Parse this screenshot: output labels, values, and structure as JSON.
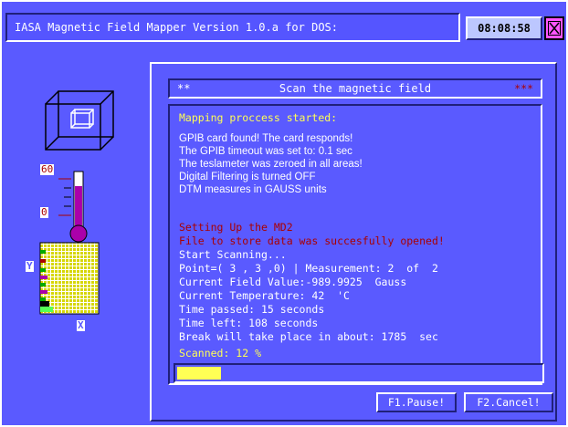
{
  "window": {
    "title": "IASA Magnetic Field Mapper Version 1.0.a for DOS:",
    "clock": "08:08:58"
  },
  "sidebar": {
    "thermometer_top_label": "60",
    "thermometer_zero_label": "0",
    "axis_y_label": "Y",
    "axis_x_label": "X"
  },
  "dialog": {
    "title_left": "**",
    "title": "Scan the magnetic field",
    "title_right": "***",
    "log": {
      "started": "Mapping proccess started:",
      "info": [
        "GPIB card found! The card responds!",
        "The GPIB timeout was set to: 0.1 sec",
        "The teslameter was zeroed in all areas!",
        "Digital Filtering is turned OFF",
        "DTM measures in GAUSS units"
      ],
      "setup": [
        "Setting Up the MD2",
        "File to store data was succesfully opened!"
      ],
      "status": [
        "Start Scanning...",
        "Point=( 3 , 3 ,0) | Measurement: 2  of  2",
        "Current Field Value:-989.9925  Gauss",
        "Current Temperature: 42  'C",
        "Time passed: 15 seconds",
        "Time left: 108 seconds",
        "Break will take place in about: 1785  sec"
      ],
      "scanned": "Scanned: 12 %"
    },
    "progress_fraction": 0.12,
    "buttons": {
      "pause": "F1.Pause!",
      "cancel": "F2.Cancel!"
    }
  },
  "colors": {
    "background": "#5a5aff",
    "highlight_text": "#ffff55",
    "alert_text": "#aa0000",
    "close_button": "#ff55ff",
    "thermometer": "#aa00aa"
  }
}
